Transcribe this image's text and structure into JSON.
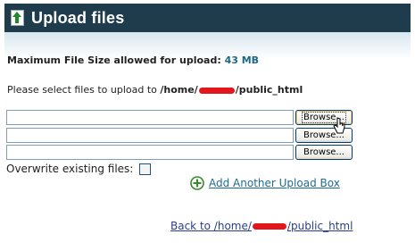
{
  "window": {
    "title": "Upload files"
  },
  "upload": {
    "max_size_label": "Maximum File Size allowed for upload:",
    "max_size_value": "43 MB",
    "select_prefix": "Please select files to upload to",
    "path_start": "/home/",
    "path_end": "/public_html",
    "file_inputs": [
      {
        "value": "",
        "browse_label": "Browse..."
      },
      {
        "value": "",
        "browse_label": "Browse..."
      },
      {
        "value": "",
        "browse_label": "Browse..."
      }
    ],
    "overwrite_label": "Overwrite existing files:",
    "overwrite_checked": false,
    "add_another_label": "Add Another Upload Box",
    "back_prefix": "Back to /home/",
    "back_suffix": "/public_html"
  },
  "colors": {
    "title_bar": "#1f3c4d",
    "accent_value": "#1b6a86",
    "link": "#1d6b95",
    "redaction": "#e3161c",
    "add_icon": "#3a8a2e"
  },
  "icons": [
    "upload-icon",
    "plus-circle-icon",
    "mouse-cursor-icon"
  ]
}
